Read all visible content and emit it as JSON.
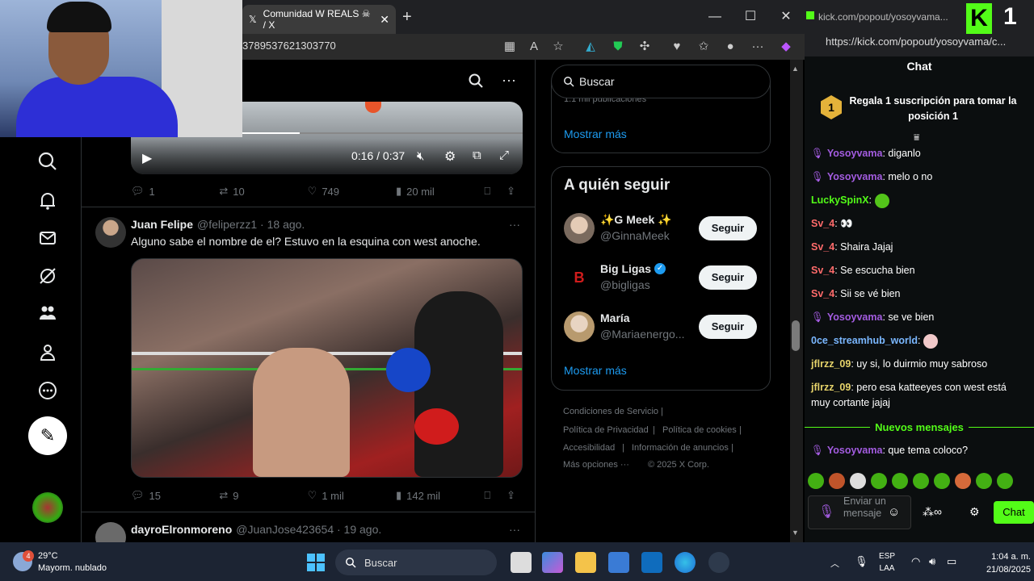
{
  "browser": {
    "tab_title": "Comunidad W REALS ☠ / X",
    "url": "3789537621303770",
    "new_tab": "+",
    "min": "—",
    "max": "☐",
    "close": "✕"
  },
  "feed": {
    "video1": {
      "time": "0:16 / 0:37"
    },
    "post1_actions": {
      "replies": "1",
      "reposts": "10",
      "likes": "749",
      "views": "20 mil"
    },
    "post2": {
      "name": "Juan Felipe",
      "handle_date": "@feliperzz1 · 18 ago.",
      "text": "Alguno sabe el nombre de el? Estuvo en la esquina con west anoche.",
      "more": "···"
    },
    "post2_actions": {
      "replies": "15",
      "reposts": "9",
      "likes": "1 mil",
      "views": "142 mil"
    },
    "post3": {
      "name": "dayroElronmoreno",
      "handle_date": "@JuanJose423654 · 19 ago.",
      "more": "···"
    }
  },
  "sidebar_right": {
    "search_placeholder": "Buscar",
    "panel1_partial": "1.1 mil publicaciones",
    "show_more_1": "Mostrar más",
    "who_to_follow_title": "A quién seguir",
    "follow": [
      {
        "name": "✨G Meek ✨",
        "handle": "@GinnaMeek",
        "button": "Seguir"
      },
      {
        "name": "Big Ligas",
        "handle": "@bigligas",
        "button": "Seguir"
      },
      {
        "name": "María",
        "handle": "@Mariaenergo...",
        "button": "Seguir"
      }
    ],
    "show_more_2": "Mostrar más",
    "footer": {
      "terms": "Condiciones de Servicio",
      "privacy": "Política de Privacidad",
      "cookies": "Política de cookies",
      "accessibility": "Accesibilidad",
      "ads": "Información de anuncios",
      "more": "Más opciones ···",
      "copyright": "© 2025 X Corp."
    }
  },
  "kick": {
    "tab_title": "kick.com/popout/yosoyvama...",
    "url": "https://kick.com/popout/yosoyvama/c...",
    "chat_title": "Chat",
    "gift_badge": "1",
    "gift_text": "Regala 1 suscripción para tomar la posición 1",
    "messages": [
      {
        "user": "Yosoyvama",
        "text": ": diganlo"
      },
      {
        "user": "Yosoyvama",
        "text": ": melo o no"
      },
      {
        "user": "LuckySpinX",
        "text": ":"
      },
      {
        "user": "Sv_4",
        "text": ": 👀"
      },
      {
        "user": "Sv_4",
        "text": ": Shaira Jajaj"
      },
      {
        "user": "Sv_4",
        "text": ": Se escucha bien"
      },
      {
        "user": "Sv_4",
        "text": ": Sii se vé bien"
      },
      {
        "user": "Yosoyvama",
        "text": ": se ve bien"
      },
      {
        "user": "0ce_streamhub_world",
        "text": ":"
      },
      {
        "user": "jflrzz_09",
        "text": ": uy si, lo duirmio muy sabroso"
      },
      {
        "user": "jflrzz_09",
        "text": ": pero esa katteeyes con west está muy cortante jajaj"
      }
    ],
    "new_messages": "Nuevos mensajes",
    "last_message": {
      "user": "Yosoyvama",
      "text": ": que tema coloco?"
    },
    "input_placeholder": "Enviar un mensaje",
    "chat_button": "Chat",
    "colors": {
      "accent": "#53fc18",
      "user_mod": "#a35ce0",
      "user_green": "#53fc18",
      "user_blue": "#7ab7ff",
      "user_yellow": "#e6d36a",
      "user_red": "#ff6b6b"
    }
  },
  "taskbar": {
    "weather_temp": "29°C",
    "weather_desc": "Mayorm. nublado",
    "weather_badge": "4",
    "search": "Buscar",
    "lang_1": "ESP",
    "lang_2": "LAA",
    "time": "1:04 a. m.",
    "date": "21/08/2025"
  }
}
